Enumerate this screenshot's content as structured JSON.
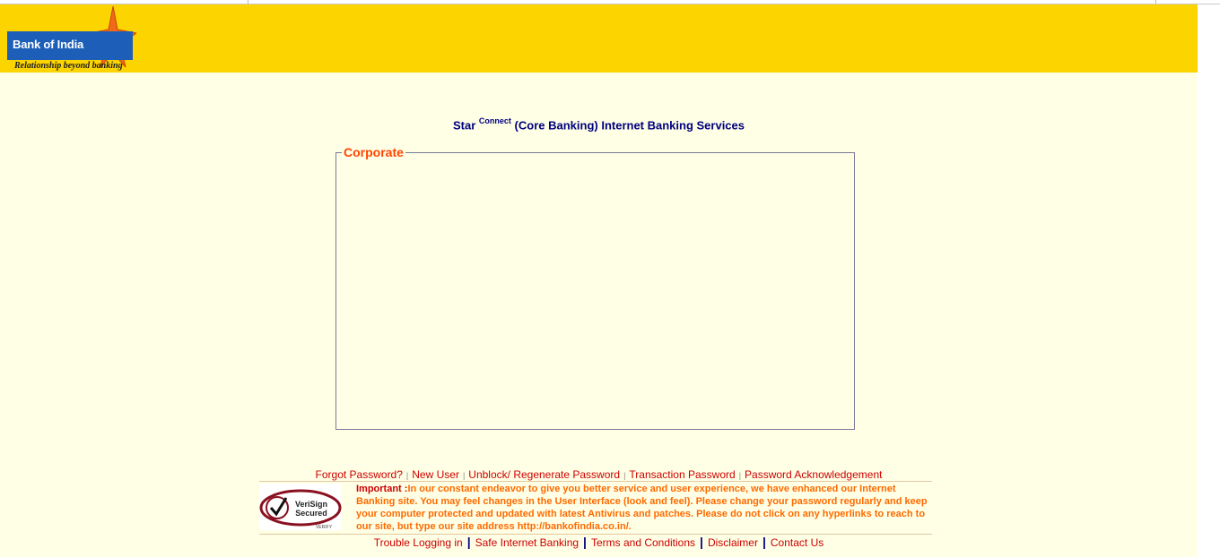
{
  "header": {
    "logo_name": "Bank of India",
    "logo_tagline": "Relationship beyond banking"
  },
  "title": {
    "main": "Star",
    "superscript": "Connect",
    "rest": "(Core Banking) Internet Banking Services"
  },
  "corporate_box": {
    "legend": "Corporate"
  },
  "links_top": [
    {
      "label": "Forgot Password?"
    },
    {
      "label": "New User"
    },
    {
      "label": "Unblock/ Regenerate Password"
    },
    {
      "label": "Transaction Password"
    },
    {
      "label": "Password Acknowledgement"
    }
  ],
  "notice": {
    "seal_line1": "VeriSign",
    "seal_line2": "Secured",
    "seal_line3": "VERIFY",
    "label": "Important :",
    "text": "In our constant endeavor to give you better service and user experience, we have enhanced our Internet Banking site. You may feel changes in the User Interface (look and feel). Please change your password regularly and keep your computer protected and updated with latest Antivirus and patches. Please do not click on any hyperlinks to reach to our site, but type our site address http://bankofindia.co.in/."
  },
  "links_bottom": [
    {
      "label": "Trouble Logging in"
    },
    {
      "label": "Safe Internet Banking"
    },
    {
      "label": "Terms and Conditions"
    },
    {
      "label": "Disclaimer"
    },
    {
      "label": "Contact Us"
    }
  ],
  "colors": {
    "header_bg": "#fcd400",
    "page_bg": "#ffffe6",
    "title": "#000080",
    "legend": "#ff4500",
    "link": "#cc0000",
    "notice": "#ff6a00"
  }
}
